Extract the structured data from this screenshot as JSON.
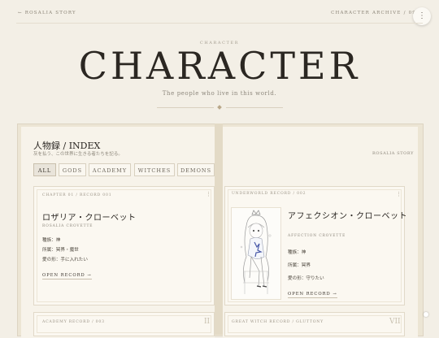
{
  "header": {
    "back_label": "← ROSALIA STORY",
    "archive_label": "CHARACTER ARCHIVE / 09",
    "menu_icon": "⋮"
  },
  "hero": {
    "kicker": "CHARACTER",
    "title": "CHARACTER",
    "subtitle": "The people who live in this world."
  },
  "index": {
    "title": "人物録 / INDEX",
    "subtitle": "灰を払う、この世界に生きる者たちを記る。",
    "tag": "ROSALIA STORY",
    "tabs": [
      "ALL",
      "GODS",
      "ACADEMY",
      "WITCHES",
      "DEMONS"
    ],
    "active_tab": "ALL"
  },
  "cards": [
    {
      "record": "CHAPTER 01 / RECORD 001",
      "name_jp": "ロザリア・クローベット",
      "name_en": "ROSALIA CROVETTE",
      "attrs": [
        "種族：神",
        "所属：冥界・魔世",
        "愛の形：手に入れたい"
      ],
      "open": "OPEN RECORD →",
      "menu_icon": "⋮"
    },
    {
      "record": "UNDERWORLD RECORD / 002",
      "name_jp": "アフェクシオン・クローベット",
      "name_en": "AFFECTION CROVETTE",
      "attrs": [
        "種族：神",
        "所属：冥界",
        "愛の形：守りたい"
      ],
      "open": "OPEN RECORD →",
      "menu_icon": "⋮"
    },
    {
      "record": "ACADEMY RECORD / 003",
      "roman": "II"
    },
    {
      "record": "GREAT WITCH RECORD / GLUTTONY",
      "roman": "VII"
    }
  ]
}
